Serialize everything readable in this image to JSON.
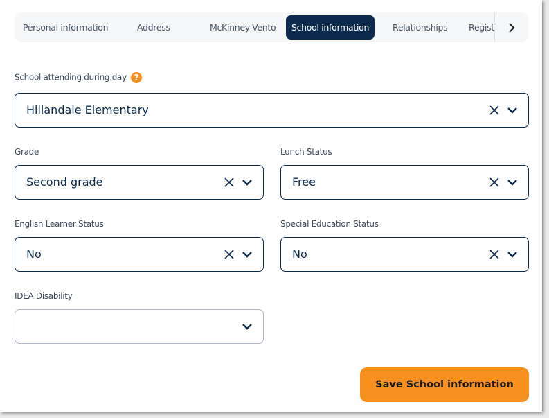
{
  "tabs": [
    {
      "label": "Personal information",
      "active": false
    },
    {
      "label": "Address",
      "active": false
    },
    {
      "label": "McKinney-Vento",
      "active": false
    },
    {
      "label": "School information",
      "active": true
    },
    {
      "label": "Relationships",
      "active": false
    },
    {
      "label": "Registr",
      "active": false
    }
  ],
  "fields": {
    "school": {
      "label": "School attending during day",
      "value": "Hillandale Elementary",
      "help_icon": "question-circle-icon"
    },
    "grade": {
      "label": "Grade",
      "value": "Second grade"
    },
    "lunch": {
      "label": "Lunch Status",
      "value": "Free"
    },
    "ell": {
      "label": "English Learner Status",
      "value": "No"
    },
    "sped": {
      "label": "Special Education Status",
      "value": "No"
    },
    "idea": {
      "label": "IDEA Disability",
      "value": ""
    }
  },
  "help_glyph": "?",
  "save_label": "Save School information",
  "colors": {
    "primary": "#0b2a4c",
    "accent": "#f7901e"
  }
}
